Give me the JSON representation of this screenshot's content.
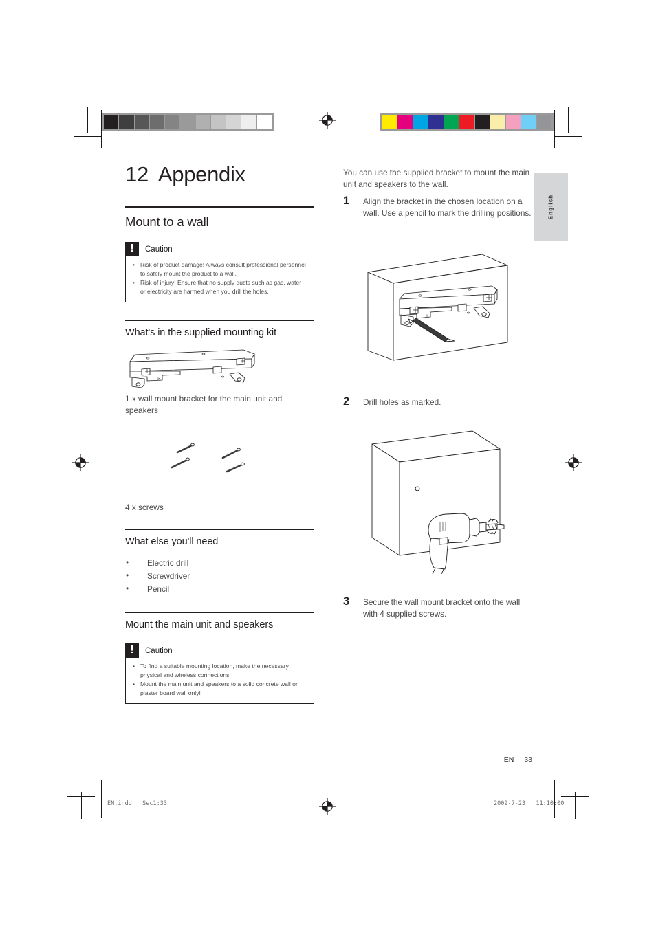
{
  "page": {
    "chapter_number": "12",
    "chapter_title": "Appendix",
    "section_title": "Mount to a wall",
    "language_tab": "English",
    "folio_locale": "EN",
    "folio_page": "33",
    "print_file": "EN.indd   Sec1:33",
    "print_stamp": "2009-7-23   11:10:00"
  },
  "caution_1": {
    "label": "Caution",
    "icon": "exclamation-icon",
    "items": [
      "Risk of product damage! Always consult professional personnel to safely mount the product to a wall.",
      "Risk of injury! Ensure that no supply ducts such as gas, water or electricity are harmed when you drill the holes."
    ]
  },
  "kit": {
    "heading": "What's in the supplied mounting kit",
    "bracket_figure": "wall-mount-bracket-illustration",
    "bracket_caption": "1 x wall mount bracket for the main unit and speakers",
    "screws_figure": "four-screws-illustration",
    "screws_caption": "4 x screws"
  },
  "needed": {
    "heading": "What else you'll need",
    "items": [
      "Electric drill",
      "Screwdriver",
      "Pencil"
    ]
  },
  "mounting": {
    "heading": "Mount the main unit and speakers"
  },
  "caution_2": {
    "label": "Caution",
    "icon": "exclamation-icon",
    "items": [
      "To find a suitable mounting location, make the necessary physical and wireless connections.",
      "Mount the main unit and speakers to a solid concrete wall or plaster board wall only!"
    ]
  },
  "procedure": {
    "intro": "You can use the supplied bracket to mount the main unit and speakers to the wall.",
    "steps": [
      {
        "num": "1",
        "text": "Align the bracket in the chosen location on a wall. Use a pencil to mark the drilling positions.",
        "figure": "bracket-aligned-on-wall-illustration"
      },
      {
        "num": "2",
        "text": "Drill holes as marked.",
        "figure": "drilling-holes-in-wall-illustration"
      },
      {
        "num": "3",
        "text": "Secure the wall mount bracket onto the wall with 4 supplied screws.",
        "figure": null
      }
    ]
  },
  "prepress": {
    "grayscale_strip": [
      "#231f20",
      "#3f3f3f",
      "#575757",
      "#6d6d6d",
      "#848484",
      "#9a9a9a",
      "#b0b0b0",
      "#c4c4c4",
      "#d5d5d5",
      "#eeeeee",
      "#ffffff"
    ],
    "color_strip": [
      "#ffeb00",
      "#e5007e",
      "#00a5e3",
      "#2e3192",
      "#00a651",
      "#ed1c24",
      "#231f20",
      "#faeeaa",
      "#f4a0bf",
      "#6fcff6",
      "#939598"
    ],
    "registration_mark": "registration-target-icon"
  }
}
